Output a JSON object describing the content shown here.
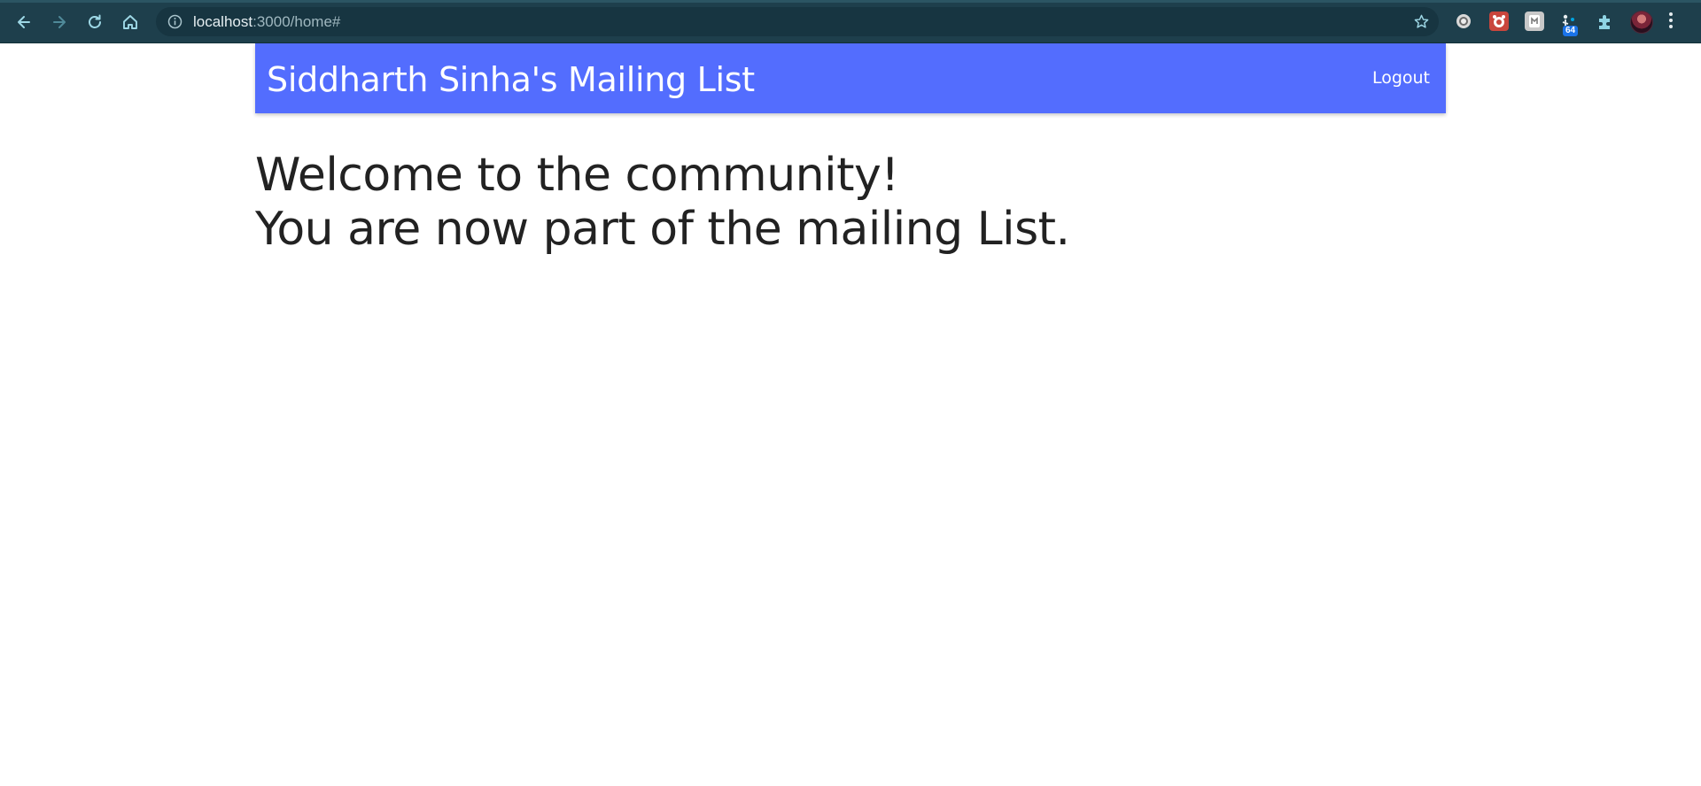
{
  "browser": {
    "url_host": "localhost",
    "url_rest": ":3000/home#",
    "extension_badge": "64",
    "icons": [
      "back-icon",
      "forward-icon",
      "reload-icon",
      "home-icon",
      "info-icon",
      "star-icon",
      "extension-icon",
      "puzzle-icon",
      "more-vert-icon"
    ]
  },
  "header": {
    "title": "Siddharth Sinha's Mailing List",
    "logout_label": "Logout",
    "accent": "#536dfe"
  },
  "main": {
    "line1": "Welcome to the community!",
    "line2": "You are now part of the mailing List."
  }
}
